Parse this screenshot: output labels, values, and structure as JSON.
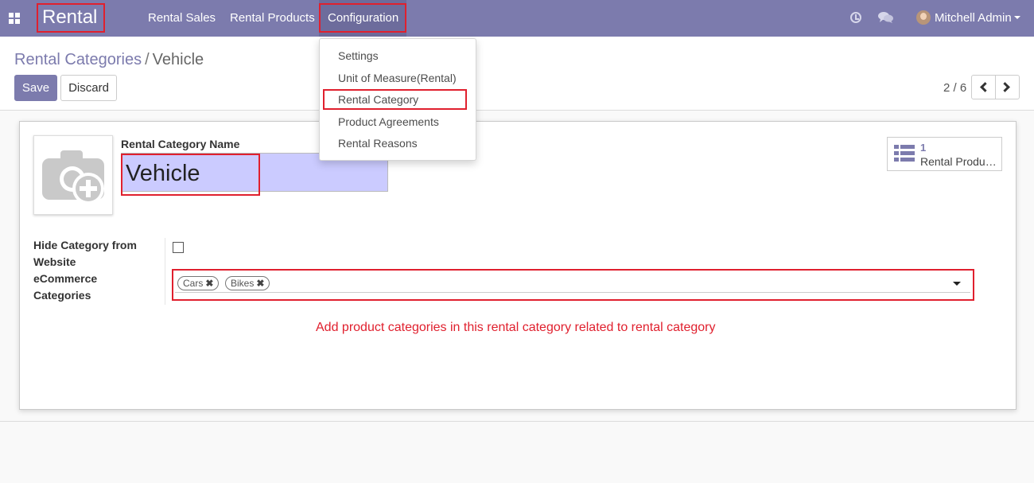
{
  "navbar": {
    "brand": "Rental",
    "menu": [
      "Rental Sales",
      "Rental Products",
      "Configuration"
    ],
    "user": "Mitchell Admin",
    "icons": [
      "apps-icon",
      "clock-icon",
      "chat-icon",
      "avatar"
    ]
  },
  "config_menu": {
    "items": [
      "Settings",
      "Unit of Measure(Rental)",
      "Rental Category",
      "Product Agreements",
      "Rental Reasons"
    ],
    "highlighted": "Rental Category"
  },
  "control_panel": {
    "breadcrumb_parent": "Rental Categories",
    "breadcrumb_separator": "/",
    "breadcrumb_current": "Vehicle",
    "save_label": "Save",
    "discard_label": "Discard",
    "pager_value": "2 / 6"
  },
  "form": {
    "name_label": "Rental Category Name",
    "name_value": "Vehicle",
    "smart_button": {
      "count": "1",
      "label": "Rental Produ…"
    },
    "hide_label_line1": "Hide Category from",
    "hide_label_line2": "Website",
    "hide_checked": false,
    "ecommerce_label_line1": "eCommerce",
    "ecommerce_label_line2": "Categories",
    "tags": [
      "Cars",
      "Bikes"
    ],
    "tag_remove_glyph": "✖"
  },
  "annotation": "Add product categories in this rental category related to rental category",
  "colors": {
    "navbar": "#7c7bad",
    "primary": "#7c7bad",
    "highlight_border": "#e0202e",
    "name_field_bg": "#cbcbff"
  }
}
